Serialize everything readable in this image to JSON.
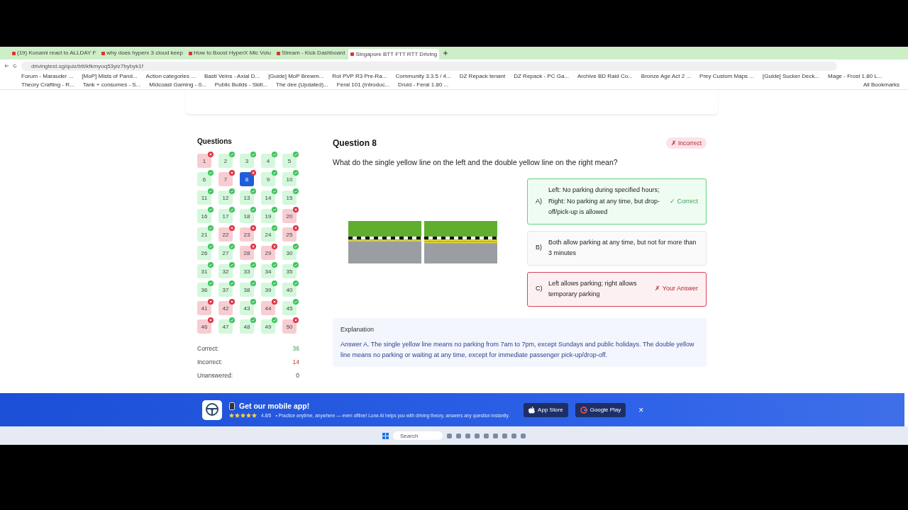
{
  "browser": {
    "tabs": [
      {
        "title": "(19) Konami react to ALLDAY F",
        "selected": false
      },
      {
        "title": "why does hyperx 3 cloud keep",
        "selected": false
      },
      {
        "title": "How to Boost HyperX Mic Volu",
        "selected": false
      },
      {
        "title": "Stream - Kick Dashboard",
        "selected": false
      },
      {
        "title": "Singapore BTT FTT RTT Driving",
        "selected": true
      }
    ],
    "url": "drivingtest.sg/quiz/btt/kfkmyoq53yiz7bybyk1f",
    "bookmarks": [
      "Forum - Marauder ...",
      "[MoP] Mists of Pand...",
      "Action categories ...",
      "Basti Veins - Axial D...",
      "[Guide] MoP Brewm...",
      "Rot PVP R3 Pre-Ra...",
      "Community 3.3.5 / 4...",
      "DZ Repack tenant",
      "DZ Repack - PC Ga...",
      "Archive BD Raid Co...",
      "Bronze Age Act 2 ...",
      "Prey Custom Maps ...",
      "[Guide] Sucker Deck...",
      "Mage - Frost 1.80 L...",
      "Theory Crafting - R...",
      "Tank + consumes - S...",
      "Midcoast Gaming - 0...",
      "Public Builds - Skill...",
      "The dee (Updated)...",
      "Feral 101 (Introduc...",
      "Druid - Feral 1.80 ..."
    ],
    "all_bookmarks": "All Bookmarks"
  },
  "questions": {
    "title": "Questions",
    "items": [
      {
        "number": "1",
        "correct": false,
        "selected": false
      },
      {
        "number": "2",
        "correct": true,
        "selected": false
      },
      {
        "number": "3",
        "correct": true,
        "selected": false
      },
      {
        "number": "4",
        "correct": true,
        "selected": false
      },
      {
        "number": "5",
        "correct": true,
        "selected": false
      },
      {
        "number": "6",
        "correct": true,
        "selected": false
      },
      {
        "number": "7",
        "correct": false,
        "selected": false
      },
      {
        "number": "8",
        "correct": false,
        "selected": true
      },
      {
        "number": "9",
        "correct": true,
        "selected": false
      },
      {
        "number": "10",
        "correct": true,
        "selected": false
      },
      {
        "number": "11",
        "correct": true,
        "selected": false
      },
      {
        "number": "12",
        "correct": true,
        "selected": false
      },
      {
        "number": "13",
        "correct": true,
        "selected": false
      },
      {
        "number": "14",
        "correct": true,
        "selected": false
      },
      {
        "number": "15",
        "correct": true,
        "selected": false
      },
      {
        "number": "16",
        "correct": true,
        "selected": false
      },
      {
        "number": "17",
        "correct": true,
        "selected": false
      },
      {
        "number": "18",
        "correct": true,
        "selected": false
      },
      {
        "number": "19",
        "correct": true,
        "selected": false
      },
      {
        "number": "20",
        "correct": false,
        "selected": false
      },
      {
        "number": "21",
        "correct": true,
        "selected": false
      },
      {
        "number": "22",
        "correct": false,
        "selected": false
      },
      {
        "number": "23",
        "correct": false,
        "selected": false
      },
      {
        "number": "24",
        "correct": true,
        "selected": false
      },
      {
        "number": "25",
        "correct": false,
        "selected": false
      },
      {
        "number": "26",
        "correct": true,
        "selected": false
      },
      {
        "number": "27",
        "correct": true,
        "selected": false
      },
      {
        "number": "28",
        "correct": false,
        "selected": false
      },
      {
        "number": "29",
        "correct": false,
        "selected": false
      },
      {
        "number": "30",
        "correct": true,
        "selected": false
      },
      {
        "number": "31",
        "correct": true,
        "selected": false
      },
      {
        "number": "32",
        "correct": true,
        "selected": false
      },
      {
        "number": "33",
        "correct": true,
        "selected": false
      },
      {
        "number": "34",
        "correct": true,
        "selected": false
      },
      {
        "number": "35",
        "correct": true,
        "selected": false
      },
      {
        "number": "36",
        "correct": true,
        "selected": false
      },
      {
        "number": "37",
        "correct": true,
        "selected": false
      },
      {
        "number": "38",
        "correct": true,
        "selected": false
      },
      {
        "number": "39",
        "correct": true,
        "selected": false
      },
      {
        "number": "40",
        "correct": true,
        "selected": false
      },
      {
        "number": "41",
        "correct": false,
        "selected": false
      },
      {
        "number": "42",
        "correct": false,
        "selected": false
      },
      {
        "number": "43",
        "correct": true,
        "selected": false
      },
      {
        "number": "44",
        "correct": false,
        "selected": false
      },
      {
        "number": "45",
        "correct": true,
        "selected": false
      },
      {
        "number": "46",
        "correct": false,
        "selected": false
      },
      {
        "number": "47",
        "correct": true,
        "selected": false
      },
      {
        "number": "48",
        "correct": true,
        "selected": false
      },
      {
        "number": "49",
        "correct": true,
        "selected": false
      },
      {
        "number": "50",
        "correct": false,
        "selected": false
      }
    ],
    "stats": [
      {
        "label": "Correct:",
        "value": "36",
        "kind": "correct"
      },
      {
        "label": "Incorrect:",
        "value": "14",
        "kind": "incorrect"
      },
      {
        "label": "Unanswered:",
        "value": "0",
        "kind": "neutral"
      }
    ]
  },
  "question": {
    "title": "Question 8",
    "badge": "✗ Incorrect",
    "text": "What do the single yellow line on the left and the double yellow line on the right mean?",
    "options": [
      {
        "letter": "A)",
        "text": "Left: No parking during specified hours; Right: No parking at any time, but drop-off/pick-up is allowed",
        "kind": "correct",
        "verdict": "✓ Correct"
      },
      {
        "letter": "B)",
        "text": "Both allow parking at any time, but not for more than 3 minutes",
        "kind": "neutral"
      },
      {
        "letter": "C)",
        "text": "Left allows parking; right allows temporary parking",
        "kind": "wrong",
        "verdict": "✗ Your Answer"
      }
    ],
    "explanation": {
      "title": "Explanation",
      "text": "Answer A. The single yellow line means no parking from 7am to 7pm, except Sundays and public holidays. The double yellow line means no parking or waiting at any time, except for immediate passenger pick-up/drop-off."
    }
  },
  "banner": {
    "title": "Get our mobile app!",
    "stars": 5,
    "rating": "4.8/5",
    "text": "• Practice anytime, anywhere — even offline! Luna AI helps you with driving theory, answers any question instantly.",
    "buttons": [
      "App Store",
      "Google Play"
    ],
    "close": "×"
  },
  "taskbar": {
    "search": "Search"
  }
}
